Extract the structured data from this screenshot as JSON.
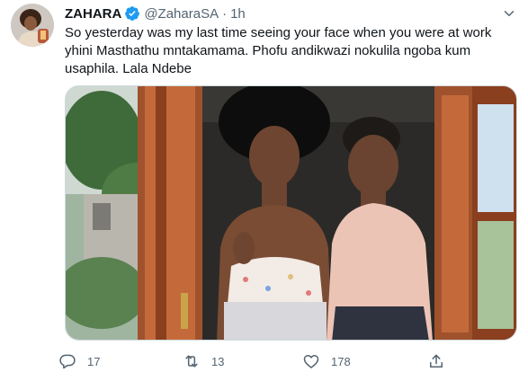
{
  "tweet": {
    "author_name": "ZAHARA",
    "handle": "@ZaharaSA",
    "separator": "·",
    "time": "1h",
    "text_lines": [
      "So yesterday was my last time seeing your face when you  were at work",
      "yhini Masthathu mntakamama. Phofu andikwazi nokulila ngoba kum",
      "usaphila. Lala Ndebe"
    ]
  },
  "actions": {
    "reply_count": "17",
    "retweet_count": "13",
    "like_count": "178"
  },
  "icons": {
    "verified": "verified-badge-icon",
    "more": "chevron-down-icon",
    "reply": "reply-icon",
    "retweet": "retweet-icon",
    "like": "heart-icon",
    "share": "share-icon"
  },
  "colors": {
    "verified": "#1d9bf0",
    "secondary_text": "#536471",
    "primary_text": "#0f1419",
    "border": "#cfd9de"
  }
}
